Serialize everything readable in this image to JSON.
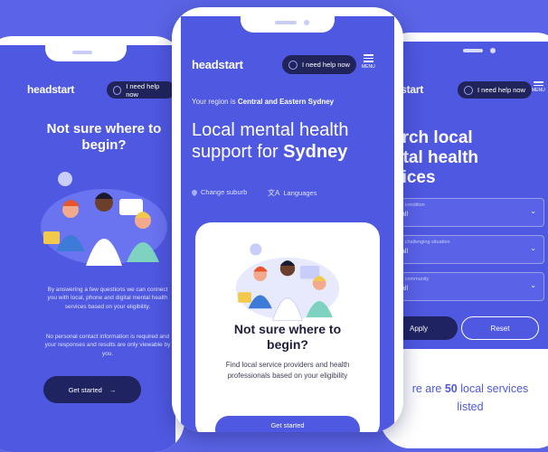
{
  "colors": {
    "background": "#5b64e6",
    "screen": "#4f58e0",
    "dark_button": "#20245a",
    "accent": "#7dd3c0"
  },
  "left_phone": {
    "logo": "headstart",
    "help_button": "I need help now",
    "heading": "Not sure where to begin?",
    "paragraph1": "By answering a few questions we can connect you with local, phone and digital mental health services based on your eligibility.",
    "paragraph2": "No personal contact information is required and your responses and results are only viewable by you.",
    "cta": "Get started",
    "cta_arrow": "→"
  },
  "center_phone": {
    "logo": "headstart",
    "help_button": "I need help now",
    "menu_label": "MENU",
    "region_prefix": "Your region is",
    "region_name": "Central and Eastern Sydney",
    "title_line1": "Local mental health",
    "title_line2_prefix": "support for",
    "title_line2_city": "Sydney",
    "change_suburb": "Change suburb",
    "languages": "Languages",
    "card_heading": "Not sure where to begin?",
    "card_text": "Find local service providers and health professionals based on your eligibility",
    "card_button": "Get started"
  },
  "right_phone": {
    "logo": "dstart",
    "help_button": "I need help now",
    "menu_label": "MENU",
    "title_line1": "arch local",
    "title_line2": "ntal health",
    "title_line3": "vices",
    "filters": [
      {
        "label": "r by condition",
        "value": "w all"
      },
      {
        "label": "r by challenging situation",
        "value": "w all"
      },
      {
        "label": "r by community",
        "value": "w all"
      }
    ],
    "apply": "Apply",
    "reset": "Reset",
    "results_prefix": "re are",
    "results_count": "50",
    "results_suffix": "local services",
    "results_line2": "listed"
  }
}
